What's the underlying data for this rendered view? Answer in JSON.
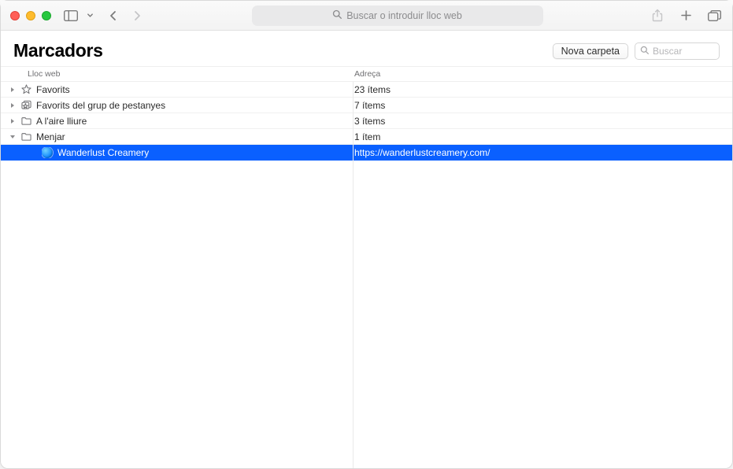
{
  "toolbar": {
    "address_placeholder": "Buscar o introduir lloc web"
  },
  "page": {
    "title": "Marcadors"
  },
  "actions": {
    "new_folder_label": "Nova carpeta",
    "search_placeholder": "Buscar"
  },
  "columns": {
    "site": "Lloc web",
    "address": "Adreça"
  },
  "rows": [
    {
      "id": "favorites",
      "type": "folder",
      "icon": "star",
      "expanded": false,
      "depth": 0,
      "name": "Favorits",
      "address": "23 ítems"
    },
    {
      "id": "tabgroups",
      "type": "folder",
      "icon": "tabgroup",
      "expanded": false,
      "depth": 0,
      "name": "Favorits del grup de pestanyes",
      "address": "7 ítems"
    },
    {
      "id": "outdoors",
      "type": "folder",
      "icon": "folder",
      "expanded": false,
      "depth": 0,
      "name": "A l'aire lliure",
      "address": "3 ítems"
    },
    {
      "id": "food",
      "type": "folder",
      "icon": "folder",
      "expanded": true,
      "depth": 0,
      "name": "Menjar",
      "address": "1 ítem"
    },
    {
      "id": "wanderlust",
      "type": "bookmark",
      "icon": "globe",
      "selected": true,
      "depth": 1,
      "name": "Wanderlust Creamery",
      "address": "https://wanderlustcreamery.com/"
    }
  ]
}
